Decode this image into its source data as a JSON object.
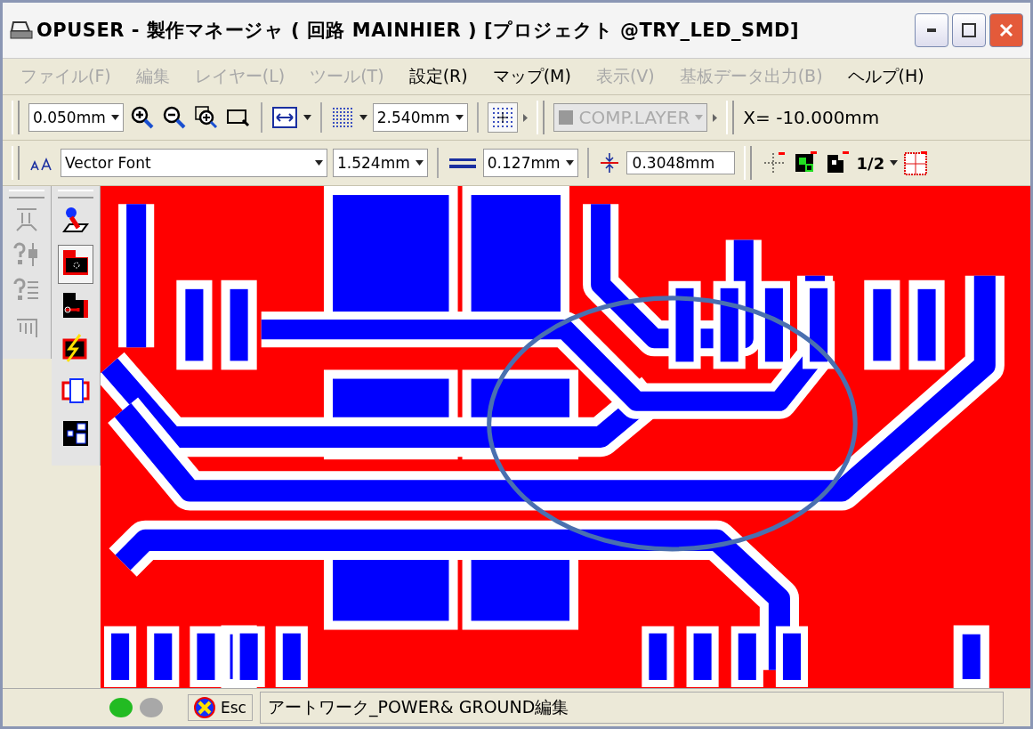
{
  "window": {
    "title": "OPUSER - 製作マネージャ ( 回路 MAINHIER ) [プロジェクト @TRY_LED_SMD]"
  },
  "menu": [
    {
      "label": "ファイル(F)",
      "disabled": true
    },
    {
      "label": "編集",
      "disabled": true
    },
    {
      "label": "レイヤー(L)",
      "disabled": true
    },
    {
      "label": "ツール(T)",
      "disabled": true
    },
    {
      "label": "設定(R)",
      "disabled": false
    },
    {
      "label": "マップ(M)",
      "disabled": false
    },
    {
      "label": "表示(V)",
      "disabled": true
    },
    {
      "label": "基板データ出力(B)",
      "disabled": true
    },
    {
      "label": "ヘルプ(H)",
      "disabled": false
    }
  ],
  "toolbar_1": {
    "zoom_step": "0.050mm",
    "grid": "2.540mm",
    "layer": "COMP.LAYER",
    "coordinate": "X= -10.000mm"
  },
  "toolbar_2": {
    "font": "Vector Font",
    "text_size": "1.524mm",
    "line_width": "0.127mm",
    "clearance": "0.3048mm",
    "ratio": "1/2"
  },
  "left_toolbar_1": [
    {
      "kind": "swap",
      "disabled": true
    },
    {
      "kind": "query-part",
      "disabled": true
    },
    {
      "kind": "query-list",
      "disabled": true
    },
    {
      "kind": "hand",
      "disabled": true
    }
  ],
  "left_toolbar_2": [
    {
      "kind": "place",
      "selected": false
    },
    {
      "kind": "pad",
      "selected": true
    },
    {
      "kind": "trace",
      "selected": false
    },
    {
      "kind": "check",
      "selected": false
    },
    {
      "kind": "outline",
      "selected": false
    },
    {
      "kind": "blocks",
      "selected": false
    }
  ],
  "status_bar": {
    "indicators": [
      {
        "color": "#22bb22"
      },
      {
        "color": "#a8a8a8"
      }
    ],
    "esc": "Esc",
    "message": "アートワーク_POWER& GROUND編集"
  }
}
